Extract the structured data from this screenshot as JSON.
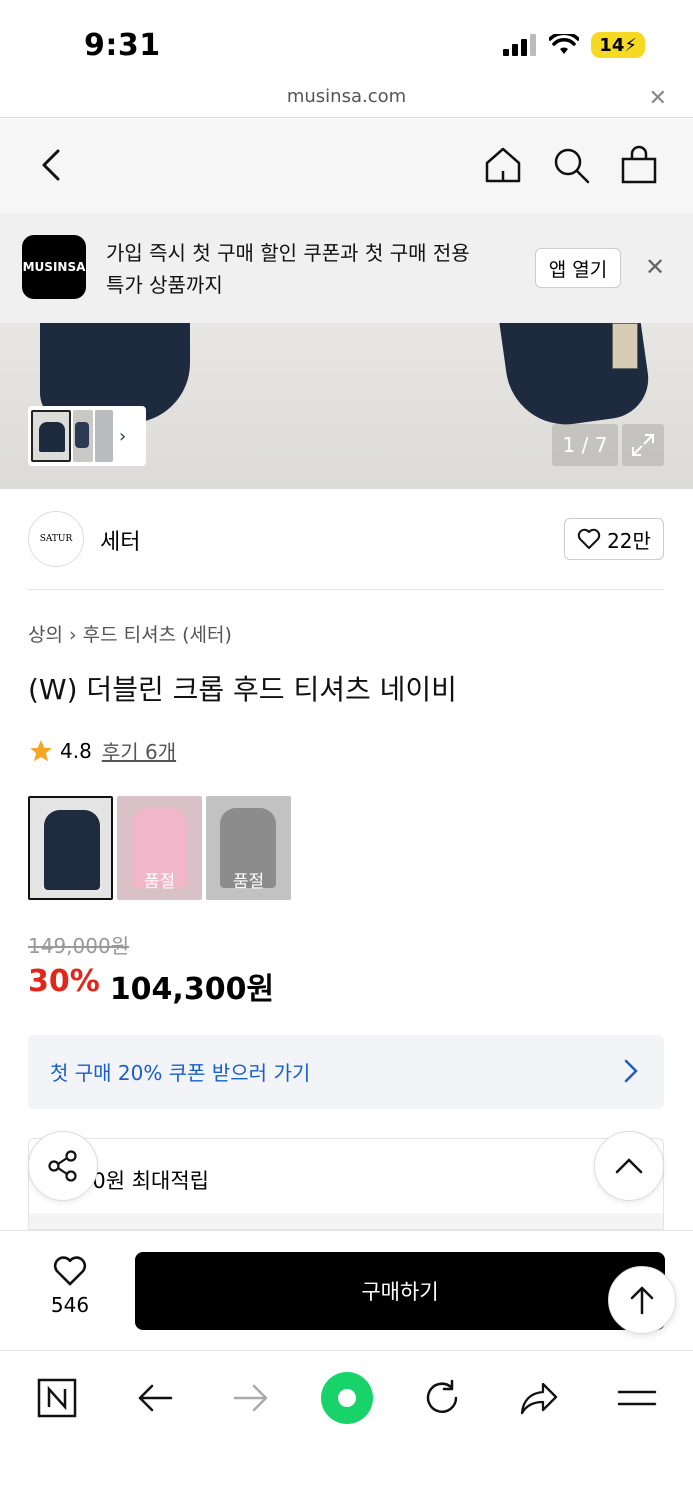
{
  "status": {
    "time": "9:31",
    "battery": "14"
  },
  "browser": {
    "url": "musinsa.com"
  },
  "banner": {
    "logo_text": "MUSINSA",
    "line1": "가입 즉시 첫 구매 할인 쿠폰과 첫 구매 전용",
    "line2": "특가 상품까지",
    "open_app": "앱 열기"
  },
  "gallery": {
    "counter": "1 / 7"
  },
  "brand": {
    "name": "세터",
    "logo_text": "SATUR",
    "likes": "22만"
  },
  "product": {
    "breadcrumb_cat1": "상의",
    "breadcrumb_cat2": "후드 티셔츠 (세터)",
    "title": "(W) 더블린 크롭 후드 티셔츠 네이비",
    "rating": "4.8",
    "reviews": "후기 6개",
    "swatches": [
      {
        "color": "#1f2b3f",
        "soldout": ""
      },
      {
        "color": "#f1b6c9",
        "soldout": "품절"
      },
      {
        "color": "#8c8c8c",
        "soldout": "품절"
      }
    ],
    "original_price": "149,000원",
    "discount": "30%",
    "price": "104,300원"
  },
  "coupon": {
    "text": "첫 구매 20% 쿠폰 받으러 가기"
  },
  "points": {
    "text": "00원 최대적립"
  },
  "buybar": {
    "wish_count": "546",
    "buy_label": "구매하기"
  },
  "colors": {
    "accent_red": "#e2261a",
    "link_blue": "#1a5fc8",
    "star": "#f5a623"
  },
  "icons": [
    "back-icon",
    "home-icon",
    "search-icon",
    "bag-icon",
    "close-icon",
    "heart-icon",
    "share-icon",
    "chevron-up-icon",
    "arrow-up-icon",
    "expand-icon",
    "star-icon"
  ]
}
